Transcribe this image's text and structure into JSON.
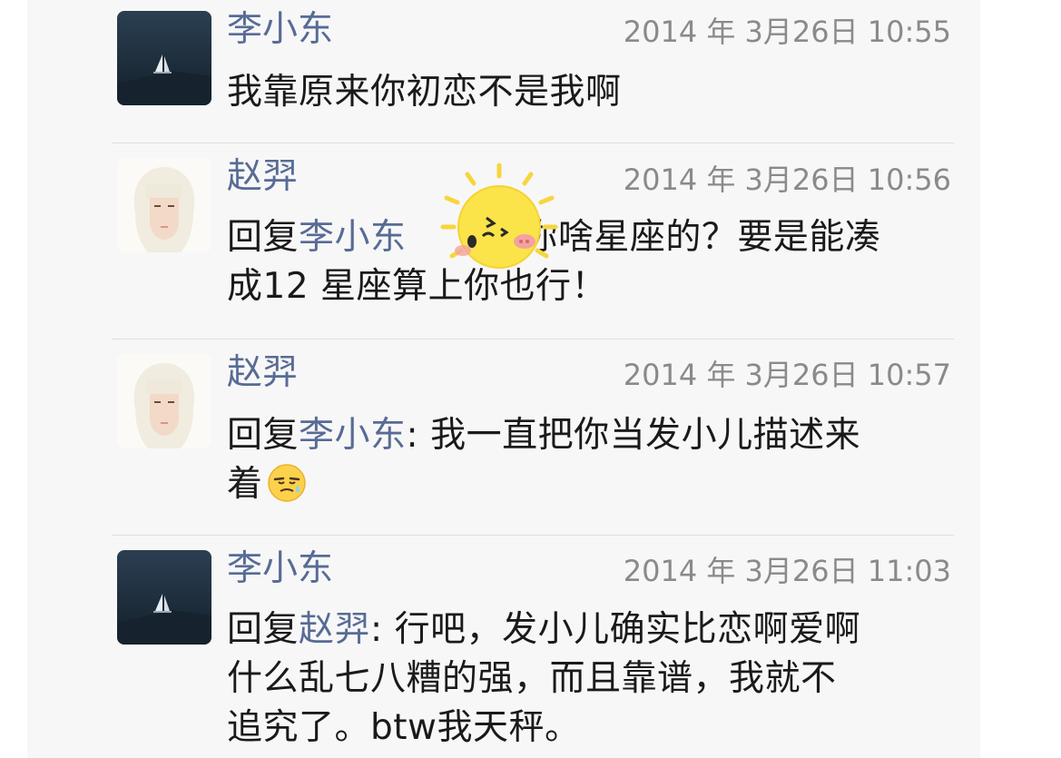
{
  "comments": [
    {
      "author": "李小东",
      "time": "2014 年 3月26日 10:55",
      "avatar": "sailboat-avatar",
      "text": "我靠原来你初恋不是我啊"
    },
    {
      "author": "赵羿",
      "time": "2014 年 3月26日 10:56",
      "avatar": "white-hair-girl-avatar",
      "reply_prefix": "回复",
      "reply_to": "李小东",
      "text_line1_rest": " 你啥星座的？要是能凑",
      "text_line2": "成12 星座算上你也行！",
      "sticker": "sun-wink-sticker"
    },
    {
      "author": "赵羿",
      "time": "2014 年 3月26日 10:57",
      "avatar": "white-hair-girl-avatar",
      "reply_prefix": "回复",
      "reply_to": "李小东",
      "text_line1_rest": ": 我一直把你当发小儿描述来",
      "text_line2": "着",
      "emoji": "sweat-smile-emoji"
    },
    {
      "author": "李小东",
      "time": "2014 年 3月26日 11:03",
      "avatar": "sailboat-avatar",
      "reply_prefix": "回复",
      "reply_to": "赵羿",
      "text_line1_rest": ": 行吧，发小儿确实比恋啊爱啊",
      "text_line2": "什么乱七八糟的强，而且靠谱，我就不",
      "text_line3": "追究了。btw我天秤。"
    }
  ],
  "colors": {
    "author": "#576b95",
    "time": "#8a8a8a",
    "text": "#1a1a1a",
    "panel": "#f7f7f7"
  }
}
